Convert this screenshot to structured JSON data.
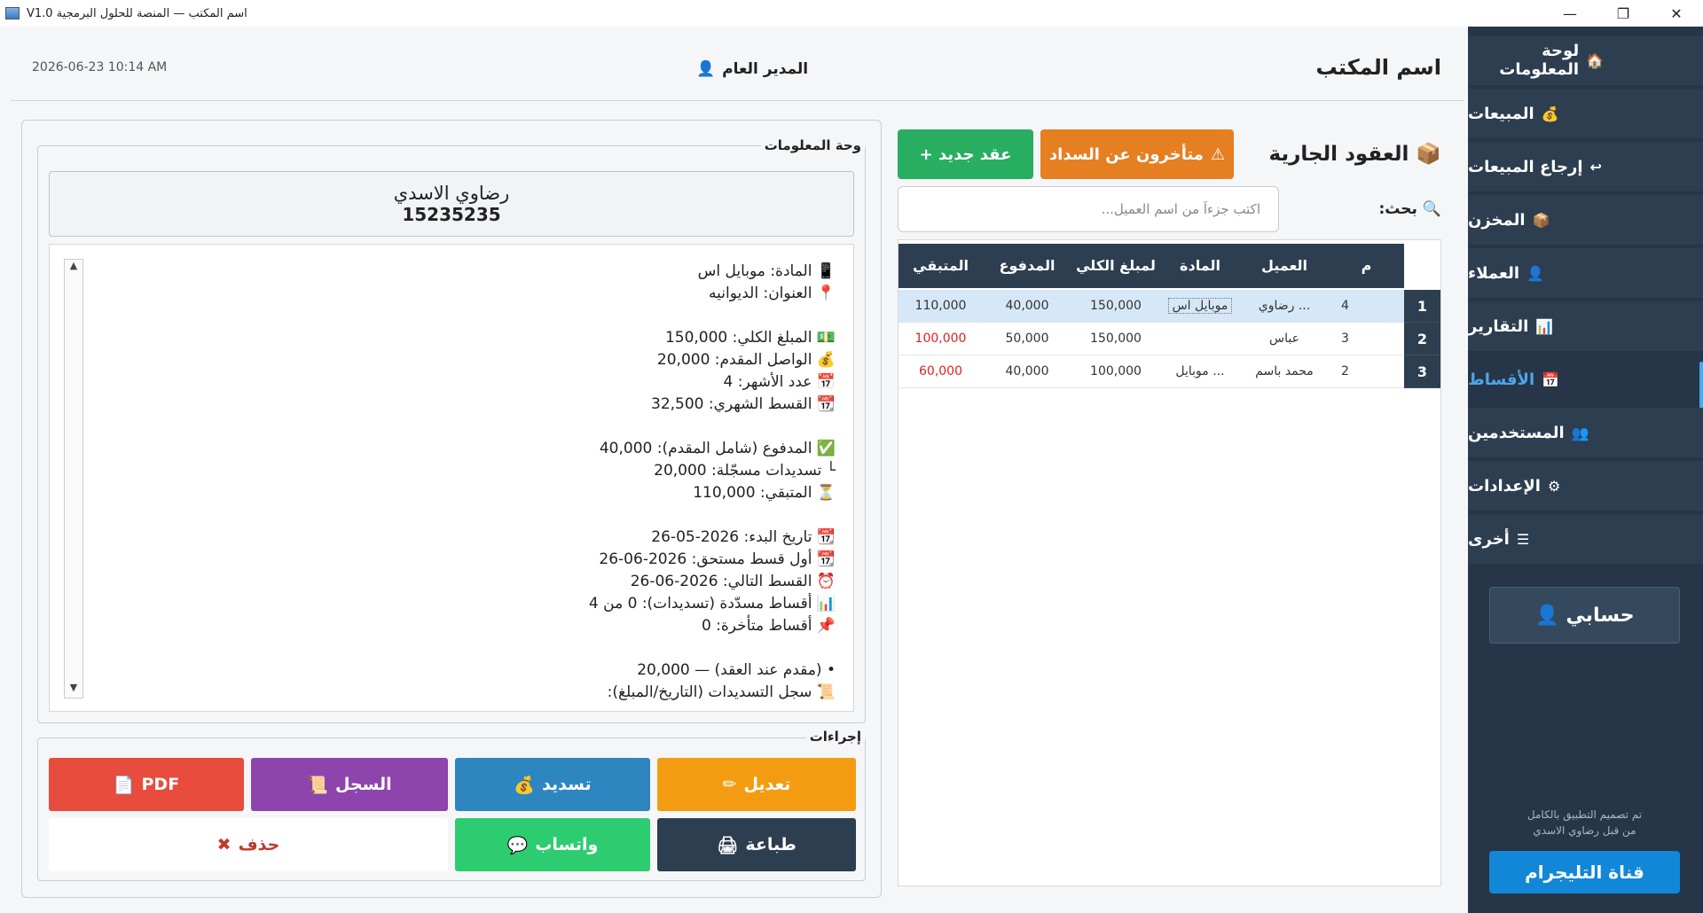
{
  "window": {
    "title": "V1.0 اسم المكتب — المنصة للحلول البرمجية",
    "controls": [
      "—",
      "❐",
      "✕"
    ]
  },
  "header": {
    "datetime": "2026-06-23  10:14 AM",
    "user": "المدير العام",
    "office": "اسم المكتب"
  },
  "sidebar": {
    "items": [
      {
        "label": "لوحة المعلومات",
        "icon": "🏠"
      },
      {
        "label": "المبيعات",
        "icon": "💰"
      },
      {
        "label": "إرجاع المبيعات",
        "icon": "↩"
      },
      {
        "label": "المخزن",
        "icon": "📦"
      },
      {
        "label": "العملاء",
        "icon": "👤"
      },
      {
        "label": "التقارير",
        "icon": "📊"
      },
      {
        "label": "الأقساط",
        "icon": "📅"
      },
      {
        "label": "المستخدمين",
        "icon": "👥"
      },
      {
        "label": "الإعدادات",
        "icon": "⚙"
      },
      {
        "label": "أخرى",
        "icon": "☰"
      }
    ],
    "active_index": 6,
    "account": "حسابي",
    "credit": [
      "تم تصميم التطبيق بالكامل",
      "من قبل رضاوي الاسدي"
    ],
    "telegram": "قناة التليجرام"
  },
  "info_panel": {
    "group_label": "وحة المعلومات",
    "customer_name": "رضاوي الاسدي",
    "customer_id": "15235235",
    "lines": [
      "📱 المادة: موبايل اس",
      "📍 العنوان: الديوانيه",
      "",
      "💵 المبلغ الكلي: 150,000",
      "💰 الواصل المقدم: 20,000",
      "📅 عدد الأشهر: 4",
      "📆 القسط الشهري: 32,500",
      "",
      "✅ المدفوع (شامل المقدم): 40,000",
      "└ تسديدات مسجّلة: 20,000",
      "⏳ المتبقي: 110,000",
      "",
      "📆 تاريخ البدء: 2026-05-26",
      "📆 أول قسط مستحق: 2026-06-26",
      "⏰ القسط التالي: 2026-06-26",
      "📊 أقساط مسدّدة (تسديدات): 0 من 4",
      "📌 أقساط متأخرة: 0",
      "",
      "• (مقدم عند العقد) — 20,000",
      "📜 سجل التسديدات (التاريخ/المبلغ):"
    ]
  },
  "actions": {
    "label": "إجراءات",
    "buttons": [
      {
        "label": "تعديل",
        "icon": "✏"
      },
      {
        "label": "تسديد",
        "icon": "💰"
      },
      {
        "label": "السجل",
        "icon": "📜"
      },
      {
        "label": "PDF",
        "icon": "📄"
      },
      {
        "label": "طباعة",
        "icon": "🖨"
      },
      {
        "label": "واتساب",
        "icon": "💬"
      },
      {
        "label": "حذف",
        "icon": "✖"
      }
    ]
  },
  "contracts": {
    "title": "العقود الجارية",
    "late_button": "متأخرون عن السداد",
    "new_button": "عقد جديد +",
    "search_label": "بحث:",
    "search_placeholder": "اكتب جزءاً من اسم العميل...",
    "columns": [
      "م",
      "العميل",
      "المادة",
      "لمبلغ الكلي",
      "المدفوع",
      "المتبقي"
    ],
    "rows": [
      {
        "n": "1",
        "m": "4",
        "client": "رضاوي ...",
        "item": "موبايل اس",
        "total": "150,000",
        "paid": "40,000",
        "remaining": "110,000",
        "remaining_color": "#333333"
      },
      {
        "n": "2",
        "m": "3",
        "client": "عباس",
        "item": "",
        "total": "150,000",
        "paid": "50,000",
        "remaining": "100,000",
        "remaining_color": "#e02020"
      },
      {
        "n": "3",
        "m": "2",
        "client": "محمد باسم",
        "item": "موبايل ...",
        "total": "100,000",
        "paid": "40,000",
        "remaining": "60,000",
        "remaining_color": "#e02020"
      }
    ]
  },
  "colors": {
    "sidebar_bg": "#263547",
    "active": "#4fa6ea",
    "edit": "#f39c12",
    "pay": "#2e86c1",
    "log": "#8e44ad",
    "pdf": "#e74c3c",
    "print": "#2c3e50",
    "whatsapp": "#2ecc71",
    "late": "#e67e22",
    "new": "#27ae60"
  }
}
